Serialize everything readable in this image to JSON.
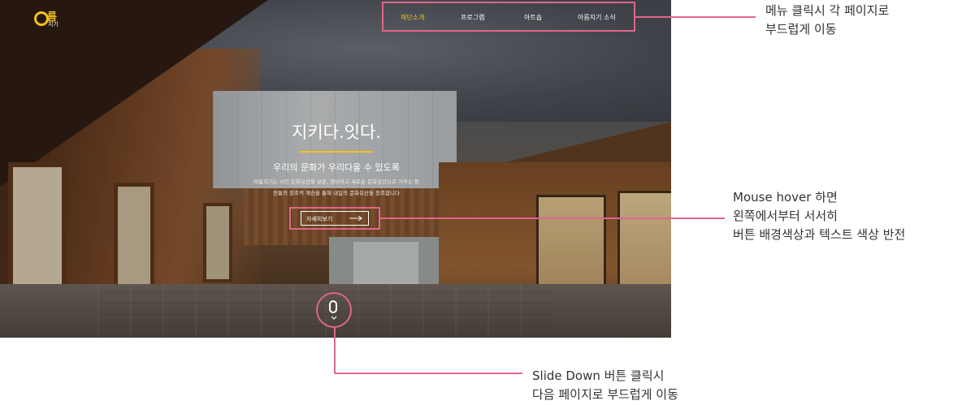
{
  "logo": {
    "main": "름",
    "sub": "지기"
  },
  "nav": {
    "items": [
      {
        "label": "재단소개",
        "active": true
      },
      {
        "label": "프로그램",
        "active": false
      },
      {
        "label": "아트숍",
        "active": false
      },
      {
        "label": "아름지기 소식",
        "active": false
      }
    ]
  },
  "hero": {
    "headline": "지키다.잇다.",
    "subtitle": "우리의 문화가 우리다울 수 있도록",
    "desc_line1": "아름지기는 시인 문화유산을 보존, 정비하고 새로운 문화공간으로 가꾸는 등",
    "desc_line2": "전통의 창조적 계승을 통해 내일의 문화유산을 창조합니다",
    "more_button": "자세히보기"
  },
  "annotations": {
    "menu": {
      "line1": "메뉴 클릭시 각 페이지로",
      "line2": "부드럽게 이동"
    },
    "hover": {
      "line1": "Mouse hover 하면",
      "line2": "왼쪽에서부터 서서히",
      "line3": "버튼 배경색상과 텍스트 색상 반전"
    },
    "slide": {
      "line1": "Slide Down 버튼 클릭시",
      "line2": "다음 페이지로 부드럽게 이동"
    }
  },
  "colors": {
    "accent": "#f2c21b",
    "annotation": "#e0668a",
    "text": "#333333"
  },
  "icons": {
    "logo": "circle-o-icon",
    "more": "long-arrow-right-icon",
    "scroll": "mouse-icon",
    "chevron": "chevron-down-icon"
  }
}
